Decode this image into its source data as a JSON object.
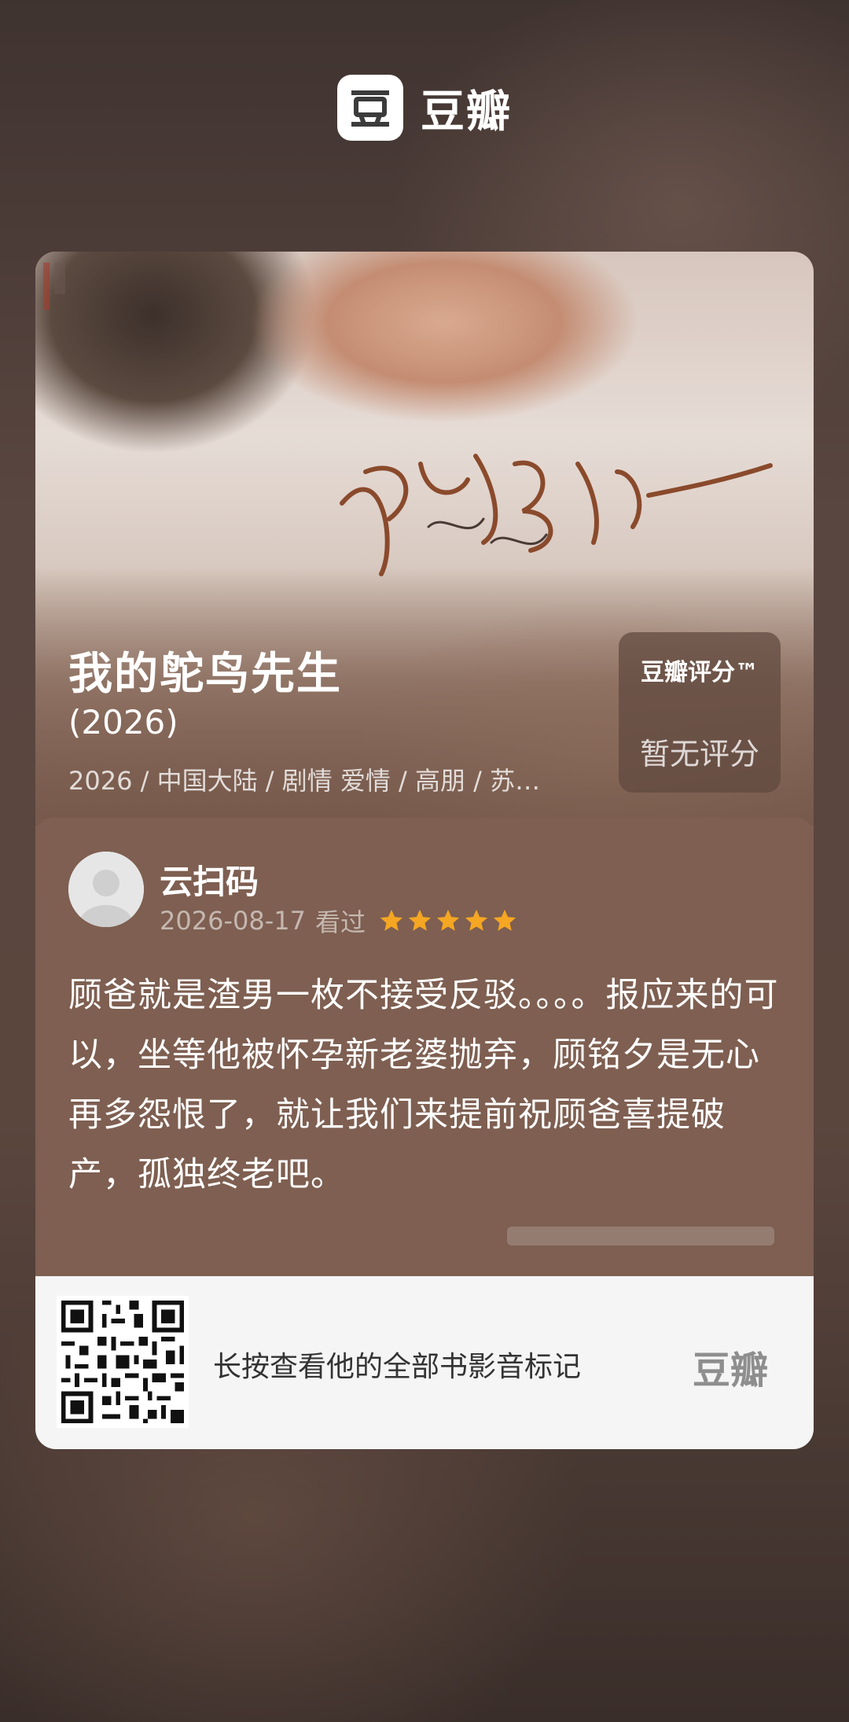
{
  "header": {
    "brand_name": "豆瓣",
    "brand_logo_icon": "douban-logo-icon"
  },
  "poster": {
    "calligraphy_icon": "movie-title-calligraphy-icon"
  },
  "movie": {
    "title": "我的鸵鸟先生",
    "year": "(2026)",
    "meta": "2026 / 中国大陆 / 剧情 爱情 / 高朋 / 苏…"
  },
  "rating": {
    "label": "豆瓣评分™",
    "value": "暂无评分"
  },
  "review": {
    "reviewer_name": "云扫码",
    "date": "2026-08-17",
    "status": "看过",
    "stars": 5,
    "text": "顾爸就是渣男一枚不接受反驳。。。。报应来的可以，坐等他被怀孕新老婆抛弃，顾铭夕是无心再多怨恨了，就让我们来提前祝顾爸喜提破产，孤独终老吧。"
  },
  "footer": {
    "prompt": "长按查看他的全部书影音标记",
    "logo_text": "豆瓣",
    "qr_icon": "qr-code-icon"
  },
  "colors": {
    "card_brown": "#7e5f51",
    "star_orange": "#f5a623",
    "footer_bg": "#f5f5f5"
  }
}
